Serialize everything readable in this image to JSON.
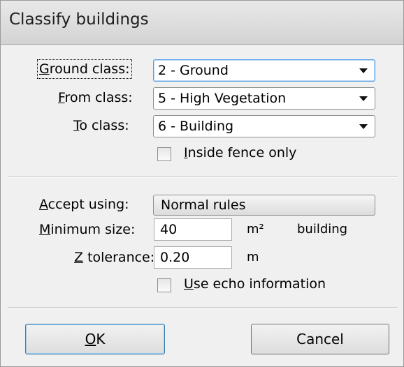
{
  "dialog": {
    "title": "Classify buildings"
  },
  "classes": {
    "ground": {
      "mnemonic": "G",
      "rest": "round class:",
      "value": "2 - Ground"
    },
    "from": {
      "mnemonic": "F",
      "rest": "rom class:",
      "value": "5 - High Vegetation"
    },
    "to": {
      "mnemonic": "T",
      "rest": "o class:",
      "value": "6 - Building"
    },
    "inside_fence": {
      "mnemonic": "I",
      "rest": "nside fence only",
      "checked": false
    }
  },
  "rules": {
    "accept": {
      "mnemonic": "A",
      "rest": "ccept using:",
      "value": "Normal rules"
    },
    "min_size": {
      "mnemonic": "M",
      "rest": "inimum size:",
      "value": "40",
      "unit": "m²",
      "suffix": "building"
    },
    "z_tolerance": {
      "mnemonic": "Z",
      "rest": " tolerance:",
      "value": "0.20",
      "unit": "m"
    },
    "echo": {
      "mnemonic": "U",
      "rest": "se echo information",
      "checked": false
    }
  },
  "buttons": {
    "ok": {
      "mnemonic": "O",
      "rest": "K"
    },
    "cancel": {
      "label": "Cancel"
    }
  }
}
